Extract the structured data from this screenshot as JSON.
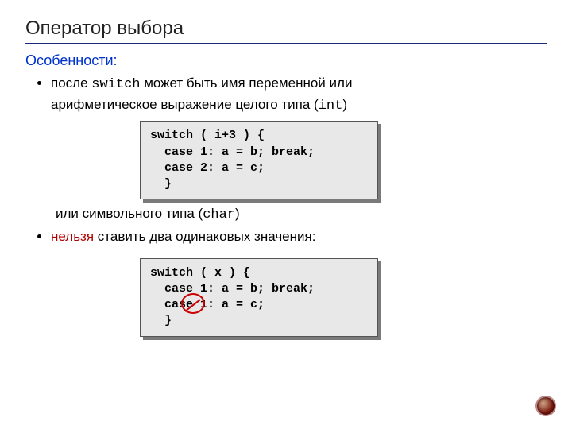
{
  "title": "Оператор выбора",
  "subhead": "Особенности:",
  "bullet1_pre": "после ",
  "bullet1_code": "switch",
  "bullet1_mid": " может быть имя переменной или",
  "bullet1_line2_pre": "арифметическое выражение целого типа (",
  "bullet1_line2_code": "int",
  "bullet1_line2_post": ")",
  "code1": "switch ( i+3 ) {\n  case 1: a = b; break;\n  case 2: a = c;\n  }",
  "after1_pre": "или символьного типа (",
  "after1_code": "char",
  "after1_post": ")",
  "bullet2_red": "нельзя",
  "bullet2_rest": " ставить два одинаковых значения:",
  "code2": "switch ( x ) {\n  case 1: a = b; break;\n  case 1: a = c;\n  }"
}
